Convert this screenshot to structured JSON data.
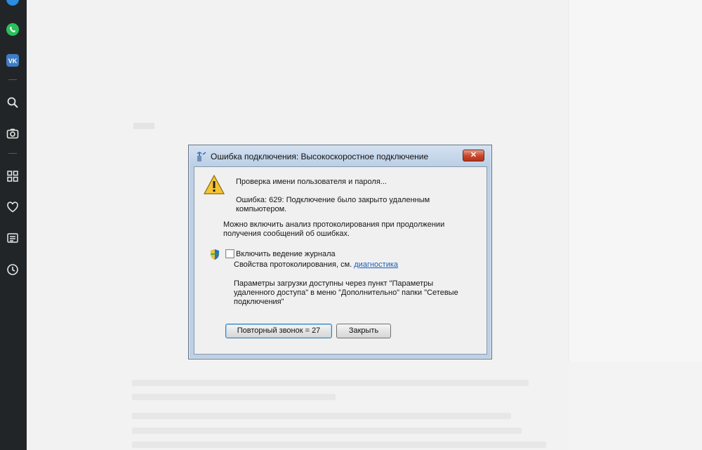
{
  "sidebar": {
    "icons": [
      "telegram-icon",
      "whatsapp-icon",
      "vk-icon",
      "search-icon",
      "camera-icon",
      "apps-grid-icon",
      "heart-icon",
      "news-icon",
      "history-icon"
    ],
    "vk_label": "VK"
  },
  "dialog": {
    "title": "Ошибка подключения: Высокоскоростное подключение",
    "close_label": "✕",
    "message_1": "Проверка имени пользователя и пароля...",
    "error_line_1": "Ошибка: 629: Подключение было закрыто удаленным",
    "error_line_2": "компьютером.",
    "logging_hint_line_1": "Можно включить анализ протоколирования при продолжении",
    "logging_hint_line_2": "получения сообщений об ошибках.",
    "checkbox_label": "Включить ведение журнала",
    "checkbox_checked": false,
    "logging_props_text": "Свойства протоколирования, см.",
    "diagnostics_link": "диагностика",
    "params_line_1": "Параметры загрузки доступны через пункт \"Параметры",
    "params_line_2": "удаленного доступа\" в меню \"Дополнительно\" папки \"Сетевые",
    "params_line_3": "подключения\"",
    "redial_button": "Повторный звонок = 27",
    "close_button": "Закрыть"
  },
  "colors": {
    "sidebar_bg": "#222527",
    "dialog_frame": "#bcd0e6",
    "close_red": "#c7452a",
    "link_blue": "#1a5fb4"
  }
}
